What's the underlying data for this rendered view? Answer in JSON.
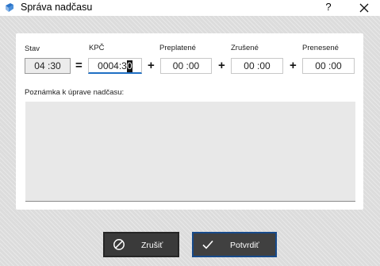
{
  "window": {
    "title": "Správa nadčasu",
    "help_label": "?"
  },
  "fields": {
    "stav": {
      "label": "Stav",
      "hours": "04",
      "minutes": "30"
    },
    "equals": "=",
    "kpc": {
      "label": "KPČ",
      "value": "0004:3",
      "caret_char": "0"
    },
    "preplatene": {
      "label": "Preplatené",
      "hours": "00",
      "minutes": "00"
    },
    "zrusene": {
      "label": "Zrušené",
      "hours": "00",
      "minutes": "00"
    },
    "prenesene": {
      "label": "Prenesené",
      "hours": "00",
      "minutes": "00"
    },
    "plus": "+"
  },
  "note": {
    "label": "Poznámka k úprave nadčasu:",
    "value": ""
  },
  "buttons": {
    "cancel": {
      "label": "Zrušiť",
      "icon": "cancel-icon"
    },
    "confirm": {
      "label": "Potvrdiť",
      "icon": "checkmark-icon"
    }
  },
  "colors": {
    "focus_underline": "#1f6fc4",
    "confirm_border": "#174a8a",
    "button_bg": "#3a3a3a"
  }
}
